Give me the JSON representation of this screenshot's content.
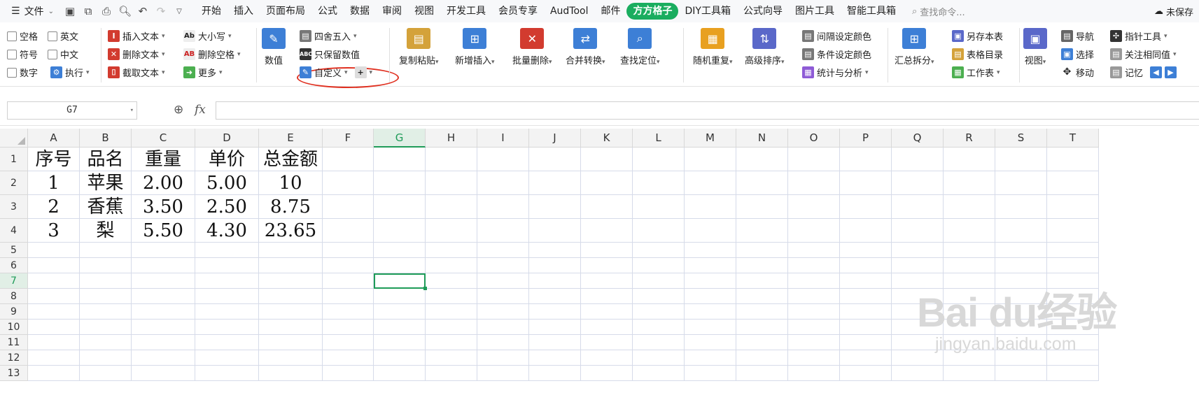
{
  "menubar": {
    "file_label": "文件",
    "tabs": [
      "开始",
      "插入",
      "页面布局",
      "公式",
      "数据",
      "审阅",
      "视图",
      "开发工具",
      "会员专享",
      "AudTool",
      "邮件",
      "方方格子",
      "DIY工具箱",
      "公式向导",
      "图片工具",
      "智能工具箱"
    ],
    "active_tab": "方方格子",
    "search_placeholder": "查找命令...",
    "unsaved_label": "未保存"
  },
  "ribbon": {
    "checkboxes": [
      "空格",
      "英文",
      "符号",
      "中文",
      "数字"
    ],
    "execute_label": "执行",
    "text_ops": [
      "插入文本",
      "删除文本",
      "截取文本"
    ],
    "case_ops": [
      "大小写",
      "删除空格",
      "更多"
    ],
    "numeric": {
      "label": "数值",
      "round": "四舍五入",
      "keep_numbers": "只保留数值",
      "custom": "自定义"
    },
    "big_buttons": [
      "复制粘贴",
      "新增插入",
      "批量删除",
      "合并转换",
      "查找定位",
      "随机重复",
      "高级排序"
    ],
    "color_ops": [
      "间隔设定颜色",
      "条件设定颜色",
      "统计与分析"
    ],
    "summary_split": "汇总拆分",
    "save_ops": [
      "另存本表",
      "表格目录",
      "工作表"
    ],
    "view_label": "视图",
    "nav_ops": [
      "导航",
      "选择",
      "移动"
    ],
    "pointer_ops": [
      "指针工具",
      "关注相同值",
      "记忆"
    ],
    "accent": "#1aad5f",
    "highlight": "#e03020"
  },
  "formula": {
    "cell_ref": "G7",
    "fx_label": "fx",
    "value": ""
  },
  "sheet": {
    "columns": [
      "A",
      "B",
      "C",
      "D",
      "E",
      "F",
      "G",
      "H",
      "I",
      "J",
      "K",
      "L",
      "M",
      "N",
      "O",
      "P",
      "Q",
      "R",
      "S",
      "T"
    ],
    "row_numbers": [
      "1",
      "2",
      "3",
      "4",
      "5",
      "6",
      "7",
      "8",
      "9",
      "10",
      "11",
      "12",
      "13"
    ],
    "selected_column": "G",
    "selected_row": "7",
    "data": [
      [
        "序号",
        "品名",
        "重量",
        "单价",
        "总金额"
      ],
      [
        "1",
        "苹果",
        "2.00",
        "5.00",
        "10"
      ],
      [
        "2",
        "香蕉",
        "3.50",
        "2.50",
        "8.75"
      ],
      [
        "3",
        "梨",
        "5.50",
        "4.30",
        "23.65"
      ]
    ],
    "selection_color": "#1e9b58"
  },
  "watermark": {
    "line1": "Bai du经验",
    "line2": "jingyan.baidu.com"
  }
}
